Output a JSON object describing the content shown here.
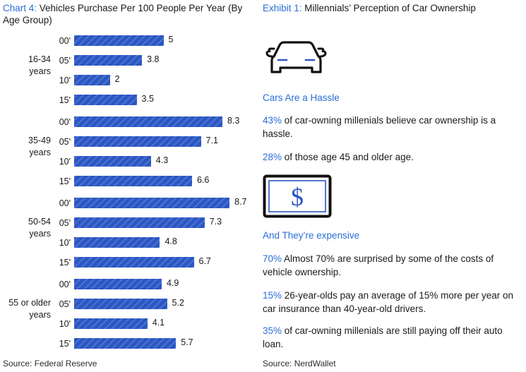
{
  "left": {
    "title_tag": "Chart 4:",
    "title_text": " Vehicles Purchase Per 100 People Per Year (By Age Group)",
    "source": "Source: Federal Reserve"
  },
  "right": {
    "title_tag": "Exhibit 1:",
    "title_text": " Millennials’ Perception of Car Ownership",
    "source": "Source: NerdWallet",
    "car_icon_name": "car-front-icon",
    "money_icon_name": "banknote-dollar-icon",
    "section_one_heading": "Cars Are a Hassle",
    "section_two_heading": "And They’re expensive",
    "stats": [
      {
        "pct": "43%",
        "text": " of car-owning millenials believe car ownership is a hassle."
      },
      {
        "pct": "28%",
        "text": " of those age 45 and older age."
      },
      {
        "pct": "70%",
        "text": " Almost 70% are surprised by some of the costs of vehicle ownership."
      },
      {
        "pct": "15%",
        "text": " 26-year-olds pay an average of 15% more per year on car insurance than 40-year-old drivers."
      },
      {
        "pct": "35%",
        "text": " of car-owning millenials are still paying off their auto loan."
      }
    ]
  },
  "colors": {
    "bar_blue": "#2b57c4",
    "accent_blue": "#2a6dd6",
    "text_black": "#1a1a1a"
  },
  "chart_data": {
    "type": "bar",
    "title": "Chart 4: Vehicles Purchase Per 100 People Per Year (By Age Group)",
    "xlabel": "",
    "ylabel": "",
    "orientation": "horizontal",
    "grid": false,
    "legend": "none",
    "xlim": [
      0,
      8.7
    ],
    "categories": [
      "00'",
      "05'",
      "10'",
      "15'"
    ],
    "groups": [
      {
        "label": "16-34 years",
        "categories": [
          "00'",
          "05'",
          "10'",
          "15'"
        ],
        "values": [
          5,
          3.8,
          2,
          3.5
        ]
      },
      {
        "label": "35-49 years",
        "categories": [
          "00'",
          "05'",
          "10'",
          "15'"
        ],
        "values": [
          8.3,
          7.1,
          4.3,
          6.6
        ]
      },
      {
        "label": "50-54 years",
        "categories": [
          "00'",
          "05'",
          "10'",
          "15'"
        ],
        "values": [
          8.7,
          7.3,
          4.8,
          6.7
        ]
      },
      {
        "label": "55 or older years",
        "categories": [
          "00'",
          "05'",
          "10'",
          "15'"
        ],
        "values": [
          4.9,
          5.2,
          4.1,
          5.7
        ]
      }
    ],
    "source": "Source: Federal Reserve"
  }
}
